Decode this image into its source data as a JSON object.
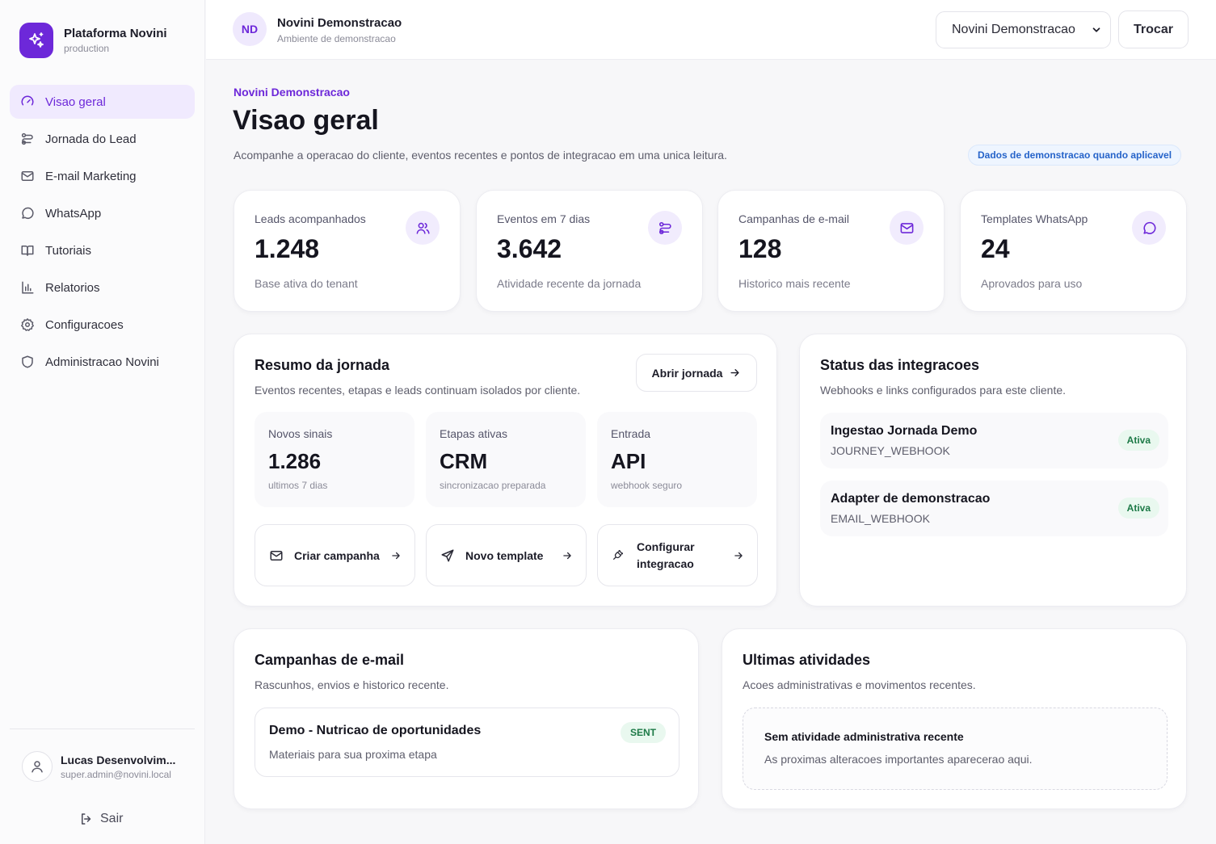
{
  "brand": {
    "name": "Plataforma Novini",
    "env": "production"
  },
  "nav": {
    "items": [
      {
        "label": "Visao geral",
        "icon": "gauge-icon",
        "active": true
      },
      {
        "label": "Jornada do Lead",
        "icon": "route-icon"
      },
      {
        "label": "E-mail Marketing",
        "icon": "mail-icon"
      },
      {
        "label": "WhatsApp",
        "icon": "chat-bubble-icon"
      },
      {
        "label": "Tutoriais",
        "icon": "book-icon"
      },
      {
        "label": "Relatorios",
        "icon": "bar-chart-icon"
      },
      {
        "label": "Configuracoes",
        "icon": "gear-icon"
      },
      {
        "label": "Administracao Novini",
        "icon": "shield-icon"
      }
    ]
  },
  "user": {
    "name": "Lucas Desenvolvim...",
    "email": "super.admin@novini.local",
    "logout_label": "Sair"
  },
  "topbar": {
    "tenant_initials": "ND",
    "tenant_name": "Novini Demonstracao",
    "tenant_subtitle": "Ambiente de demonstracao",
    "tenant_select_value": "Novini Demonstracao",
    "switch_label": "Trocar"
  },
  "header": {
    "breadcrumb": "Novini Demonstracao",
    "title": "Visao geral",
    "description": "Acompanhe a operacao do cliente, eventos recentes e pontos de integracao em uma unica leitura.",
    "demo_badge": "Dados de demonstracao quando aplicavel"
  },
  "stats": [
    {
      "label": "Leads acompanhados",
      "value": "1.248",
      "foot": "Base ativa do tenant",
      "icon": "users-icon"
    },
    {
      "label": "Eventos em 7 dias",
      "value": "3.642",
      "foot": "Atividade recente da jornada",
      "icon": "route-icon"
    },
    {
      "label": "Campanhas de e-mail",
      "value": "128",
      "foot": "Historico mais recente",
      "icon": "mail-icon"
    },
    {
      "label": "Templates WhatsApp",
      "value": "24",
      "foot": "Aprovados para uso",
      "icon": "chat-bubble-icon"
    }
  ],
  "journey": {
    "title": "Resumo da jornada",
    "subtitle": "Eventos recentes, etapas e leads continuam isolados por cliente.",
    "open_label": "Abrir jornada",
    "metrics": [
      {
        "label": "Novos sinais",
        "value": "1.286",
        "foot": "ultimos 7 dias"
      },
      {
        "label": "Etapas ativas",
        "value": "CRM",
        "foot": "sincronizacao preparada"
      },
      {
        "label": "Entrada",
        "value": "API",
        "foot": "webhook seguro"
      }
    ],
    "actions": [
      {
        "label": "Criar campanha",
        "icon": "mail-icon"
      },
      {
        "label": "Novo template",
        "icon": "send-icon"
      },
      {
        "label_line1": "Configurar",
        "label_line2": "integracao",
        "icon": "plug-icon"
      }
    ]
  },
  "integrations": {
    "title": "Status das integracoes",
    "subtitle": "Webhooks e links configurados para este cliente.",
    "items": [
      {
        "name": "Ingestao Jornada Demo",
        "code": "JOURNEY_WEBHOOK",
        "status": "Ativa"
      },
      {
        "name": "Adapter de demonstracao",
        "code": "EMAIL_WEBHOOK",
        "status": "Ativa"
      }
    ]
  },
  "campaigns": {
    "title": "Campanhas de e-mail",
    "subtitle": "Rascunhos, envios e historico recente.",
    "items": [
      {
        "title": "Demo - Nutricao de oportunidades",
        "description": "Materiais para sua proxima etapa",
        "status": "SENT"
      }
    ]
  },
  "activity": {
    "title": "Ultimas atividades",
    "subtitle": "Acoes administrativas e movimentos recentes.",
    "empty_title": "Sem atividade administrativa recente",
    "empty_desc": "As proximas alteracoes importantes aparecerao aqui."
  },
  "colors": {
    "accent": "#6d28d9",
    "accent_soft": "#f0eafe",
    "success": "#1d7a47",
    "info": "#2563c9"
  }
}
